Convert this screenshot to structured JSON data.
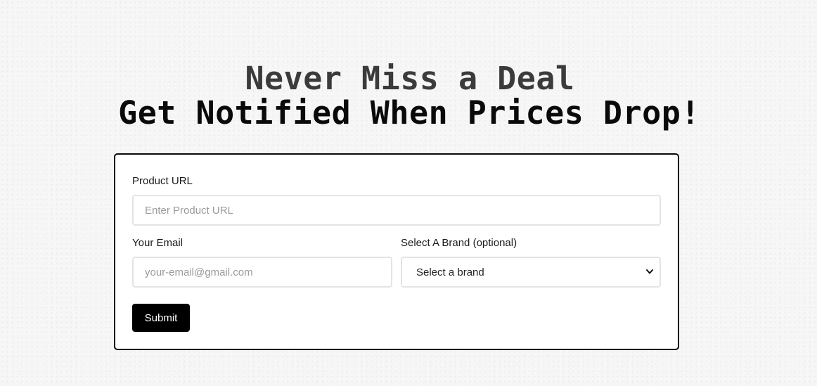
{
  "hero": {
    "line1": "Never Miss a Deal",
    "line2": "Get Notified When Prices Drop!"
  },
  "form": {
    "product_url": {
      "label": "Product URL",
      "placeholder": "Enter Product URL",
      "value": ""
    },
    "email": {
      "label": "Your Email",
      "placeholder": "your-email@gmail.com",
      "value": ""
    },
    "brand": {
      "label": "Select A Brand (optional)",
      "selected": "Select a brand"
    },
    "submit_label": "Submit"
  },
  "icons": {
    "brand_dropdown": "chevron-down-icon"
  },
  "colors": {
    "page_background": "#f6f6f6",
    "card_border": "#0a0a0a",
    "button_background": "#000000",
    "button_text": "#ffffff",
    "input_border": "#e4e4e4",
    "heading_line1": "#3b3b3b"
  }
}
